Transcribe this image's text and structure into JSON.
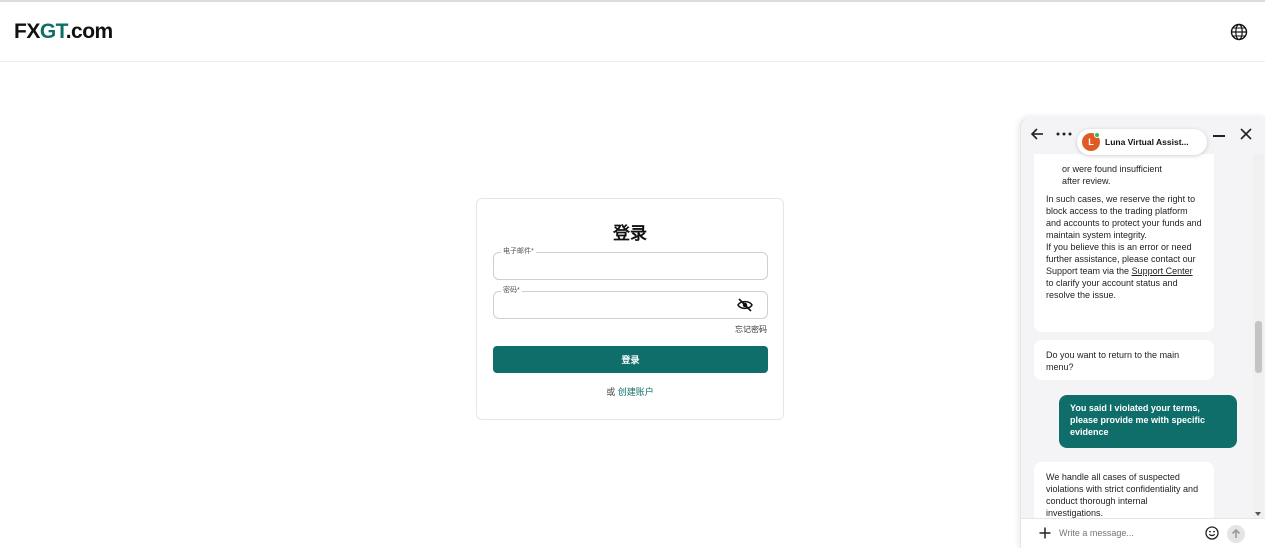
{
  "header": {
    "logo_fx": "FX",
    "logo_gt": "GT",
    "logo_com": ".com",
    "language_icon": "globe-icon"
  },
  "login": {
    "title": "登录",
    "email_label": "电子邮件*",
    "email_value": "",
    "password_label": "密码*",
    "password_value": "",
    "password_toggle_icon": "eye-slash-icon",
    "forgot_password": "忘记密码",
    "submit_label": "登录",
    "or_text": "或",
    "create_account": "创建账户"
  },
  "chat": {
    "agent_name": "Luna Virtual Assist...",
    "agent_initial": "L",
    "icons": {
      "back": "arrow-left-icon",
      "more": "more-dots-icon",
      "minimize": "minimize-icon",
      "close": "close-icon"
    },
    "messages": {
      "m1_line1": "or were found insufficient",
      "m1_line2": "after review.",
      "m1_para1": "In such cases, we reserve the right to block access to the trading platform and accounts to protect your funds and maintain system integrity.",
      "m1_para2_pre": "If you believe this is an error or need further assistance, please contact our Support team via the ",
      "m1_link": "Support Center",
      "m1_para2_post": " to clarify your account status and resolve the issue.",
      "m2": "Do you want to return to the main menu?",
      "m3_user": "You said I violated your terms, please provide me with specific evidence",
      "m4": "We handle all cases of suspected violations with strict confidentiality and conduct thorough internal investigations."
    },
    "composer_placeholder": "Write a message...",
    "colors": {
      "brand": "#0f6e6a",
      "avatar": "#e05a24",
      "online": "#2dbd5a"
    }
  }
}
